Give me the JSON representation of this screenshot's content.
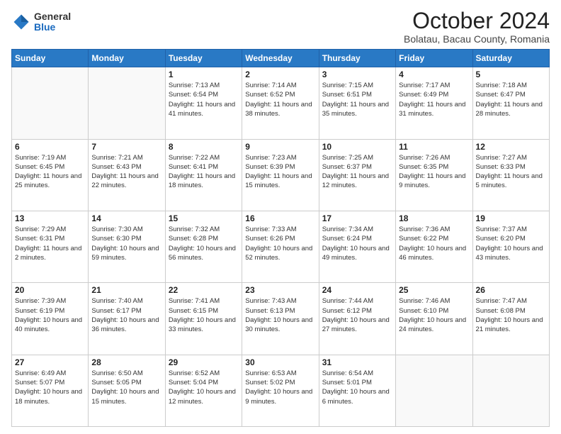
{
  "header": {
    "logo_general": "General",
    "logo_blue": "Blue",
    "title": "October 2024",
    "location": "Bolatau, Bacau County, Romania"
  },
  "weekdays": [
    "Sunday",
    "Monday",
    "Tuesday",
    "Wednesday",
    "Thursday",
    "Friday",
    "Saturday"
  ],
  "weeks": [
    [
      {
        "day": "",
        "info": ""
      },
      {
        "day": "",
        "info": ""
      },
      {
        "day": "1",
        "info": "Sunrise: 7:13 AM\nSunset: 6:54 PM\nDaylight: 11 hours and 41 minutes."
      },
      {
        "day": "2",
        "info": "Sunrise: 7:14 AM\nSunset: 6:52 PM\nDaylight: 11 hours and 38 minutes."
      },
      {
        "day": "3",
        "info": "Sunrise: 7:15 AM\nSunset: 6:51 PM\nDaylight: 11 hours and 35 minutes."
      },
      {
        "day": "4",
        "info": "Sunrise: 7:17 AM\nSunset: 6:49 PM\nDaylight: 11 hours and 31 minutes."
      },
      {
        "day": "5",
        "info": "Sunrise: 7:18 AM\nSunset: 6:47 PM\nDaylight: 11 hours and 28 minutes."
      }
    ],
    [
      {
        "day": "6",
        "info": "Sunrise: 7:19 AM\nSunset: 6:45 PM\nDaylight: 11 hours and 25 minutes."
      },
      {
        "day": "7",
        "info": "Sunrise: 7:21 AM\nSunset: 6:43 PM\nDaylight: 11 hours and 22 minutes."
      },
      {
        "day": "8",
        "info": "Sunrise: 7:22 AM\nSunset: 6:41 PM\nDaylight: 11 hours and 18 minutes."
      },
      {
        "day": "9",
        "info": "Sunrise: 7:23 AM\nSunset: 6:39 PM\nDaylight: 11 hours and 15 minutes."
      },
      {
        "day": "10",
        "info": "Sunrise: 7:25 AM\nSunset: 6:37 PM\nDaylight: 11 hours and 12 minutes."
      },
      {
        "day": "11",
        "info": "Sunrise: 7:26 AM\nSunset: 6:35 PM\nDaylight: 11 hours and 9 minutes."
      },
      {
        "day": "12",
        "info": "Sunrise: 7:27 AM\nSunset: 6:33 PM\nDaylight: 11 hours and 5 minutes."
      }
    ],
    [
      {
        "day": "13",
        "info": "Sunrise: 7:29 AM\nSunset: 6:31 PM\nDaylight: 11 hours and 2 minutes."
      },
      {
        "day": "14",
        "info": "Sunrise: 7:30 AM\nSunset: 6:30 PM\nDaylight: 10 hours and 59 minutes."
      },
      {
        "day": "15",
        "info": "Sunrise: 7:32 AM\nSunset: 6:28 PM\nDaylight: 10 hours and 56 minutes."
      },
      {
        "day": "16",
        "info": "Sunrise: 7:33 AM\nSunset: 6:26 PM\nDaylight: 10 hours and 52 minutes."
      },
      {
        "day": "17",
        "info": "Sunrise: 7:34 AM\nSunset: 6:24 PM\nDaylight: 10 hours and 49 minutes."
      },
      {
        "day": "18",
        "info": "Sunrise: 7:36 AM\nSunset: 6:22 PM\nDaylight: 10 hours and 46 minutes."
      },
      {
        "day": "19",
        "info": "Sunrise: 7:37 AM\nSunset: 6:20 PM\nDaylight: 10 hours and 43 minutes."
      }
    ],
    [
      {
        "day": "20",
        "info": "Sunrise: 7:39 AM\nSunset: 6:19 PM\nDaylight: 10 hours and 40 minutes."
      },
      {
        "day": "21",
        "info": "Sunrise: 7:40 AM\nSunset: 6:17 PM\nDaylight: 10 hours and 36 minutes."
      },
      {
        "day": "22",
        "info": "Sunrise: 7:41 AM\nSunset: 6:15 PM\nDaylight: 10 hours and 33 minutes."
      },
      {
        "day": "23",
        "info": "Sunrise: 7:43 AM\nSunset: 6:13 PM\nDaylight: 10 hours and 30 minutes."
      },
      {
        "day": "24",
        "info": "Sunrise: 7:44 AM\nSunset: 6:12 PM\nDaylight: 10 hours and 27 minutes."
      },
      {
        "day": "25",
        "info": "Sunrise: 7:46 AM\nSunset: 6:10 PM\nDaylight: 10 hours and 24 minutes."
      },
      {
        "day": "26",
        "info": "Sunrise: 7:47 AM\nSunset: 6:08 PM\nDaylight: 10 hours and 21 minutes."
      }
    ],
    [
      {
        "day": "27",
        "info": "Sunrise: 6:49 AM\nSunset: 5:07 PM\nDaylight: 10 hours and 18 minutes."
      },
      {
        "day": "28",
        "info": "Sunrise: 6:50 AM\nSunset: 5:05 PM\nDaylight: 10 hours and 15 minutes."
      },
      {
        "day": "29",
        "info": "Sunrise: 6:52 AM\nSunset: 5:04 PM\nDaylight: 10 hours and 12 minutes."
      },
      {
        "day": "30",
        "info": "Sunrise: 6:53 AM\nSunset: 5:02 PM\nDaylight: 10 hours and 9 minutes."
      },
      {
        "day": "31",
        "info": "Sunrise: 6:54 AM\nSunset: 5:01 PM\nDaylight: 10 hours and 6 minutes."
      },
      {
        "day": "",
        "info": ""
      },
      {
        "day": "",
        "info": ""
      }
    ]
  ]
}
